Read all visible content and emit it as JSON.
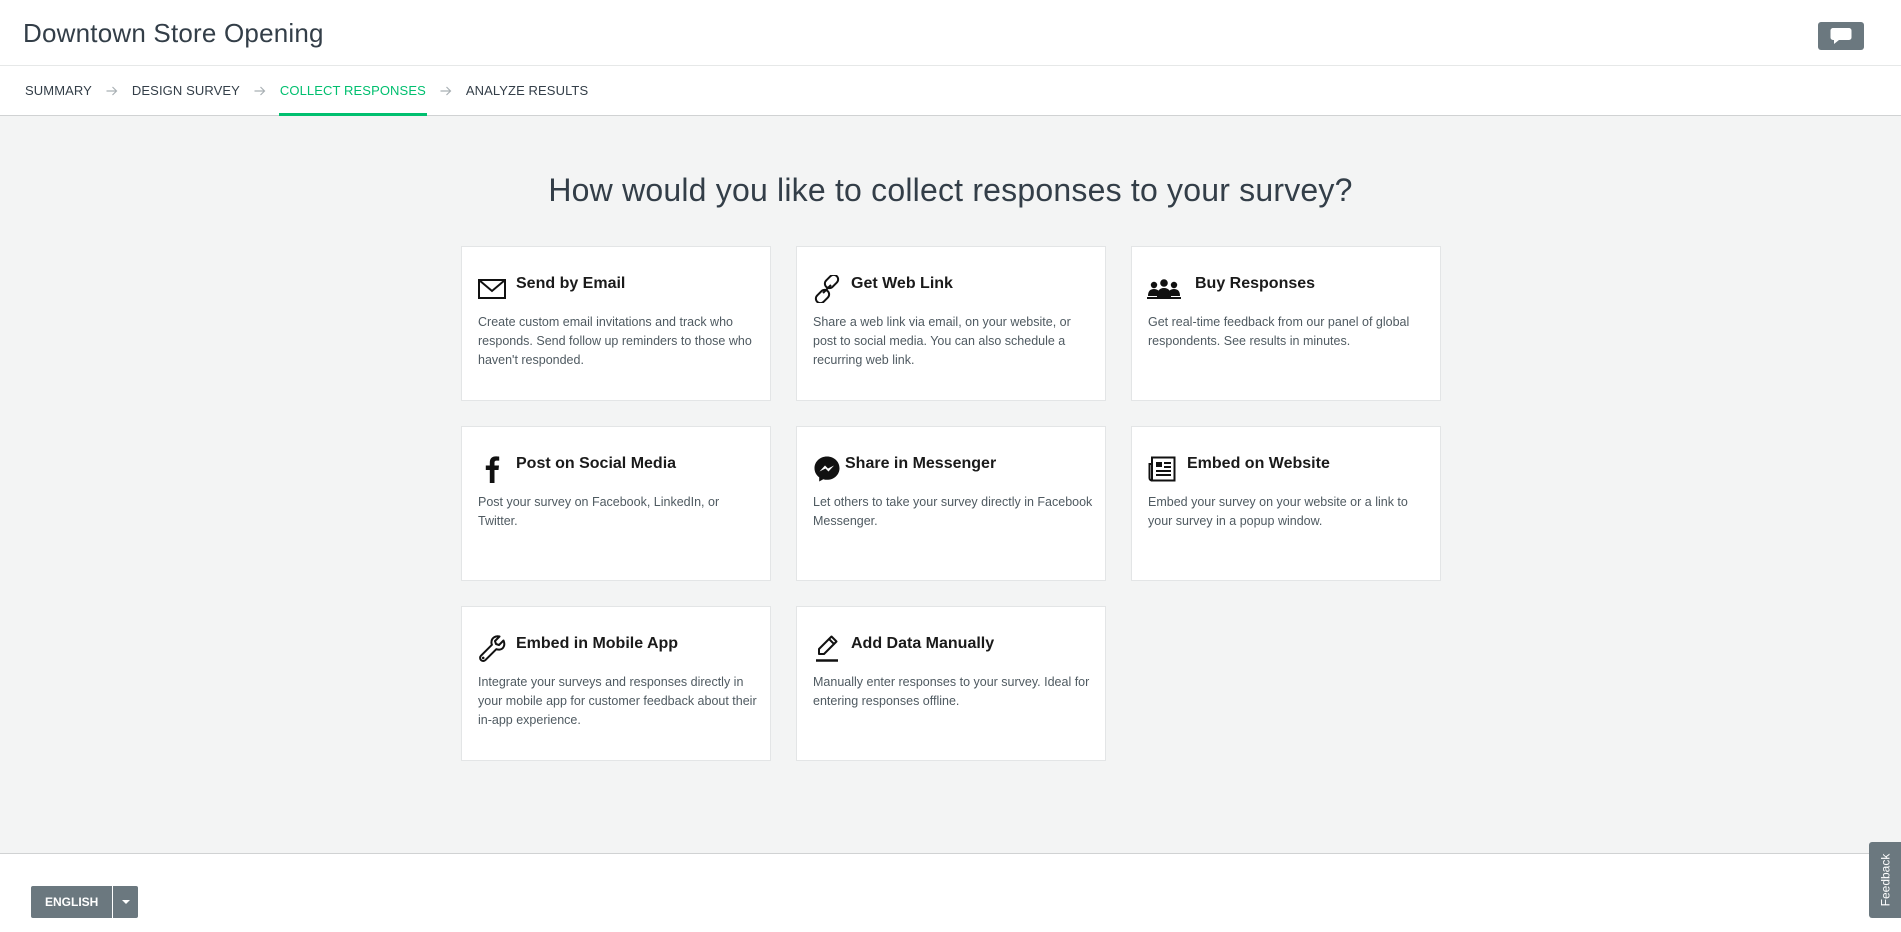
{
  "header": {
    "title": "Downtown Store Opening",
    "chat_icon": "speech-bubble-icon"
  },
  "nav": {
    "steps": [
      {
        "label": "SUMMARY"
      },
      {
        "label": "DESIGN SURVEY"
      },
      {
        "label": "COLLECT RESPONSES",
        "active": true
      },
      {
        "label": "ANALYZE RESULTS"
      }
    ]
  },
  "main": {
    "heading": "How would you like to collect responses to your survey?",
    "cards": [
      {
        "title": "Send by Email",
        "icon": "envelope-icon",
        "description": "Create custom email invitations and track who responds. Send follow up reminders to those who haven't responded."
      },
      {
        "title": "Get Web Link",
        "icon": "link-icon",
        "description": "Share a web link via email, on your website, or post to social media. You can also schedule a recurring web link."
      },
      {
        "title": "Buy Responses",
        "icon": "people-group-icon",
        "description": "Get real-time feedback from our panel of global respondents. See results in minutes."
      },
      {
        "title": "Post on Social Media",
        "icon": "facebook-icon",
        "description": "Post your survey on Facebook, LinkedIn, or Twitter."
      },
      {
        "title": "Share in Messenger",
        "icon": "messenger-icon",
        "description": "Let others to take your survey directly in Facebook Messenger."
      },
      {
        "title": "Embed on Website",
        "icon": "website-embed-icon",
        "description": "Embed your survey on your website or a link to your survey in a popup window."
      },
      {
        "title": "Embed in Mobile App",
        "icon": "wrench-icon",
        "description": "Integrate your surveys and responses directly in your mobile app for customer feedback about their in-app experience."
      },
      {
        "title": "Add Data Manually",
        "icon": "pencil-icon",
        "description": "Manually enter responses to your survey. Ideal for entering responses offline."
      }
    ]
  },
  "footer": {
    "language": "ENGLISH"
  },
  "feedback": {
    "label": "Feedback"
  },
  "colors": {
    "accent": "#00bf6f",
    "button_gray": "#6b787f",
    "background": "#f3f4f4"
  }
}
